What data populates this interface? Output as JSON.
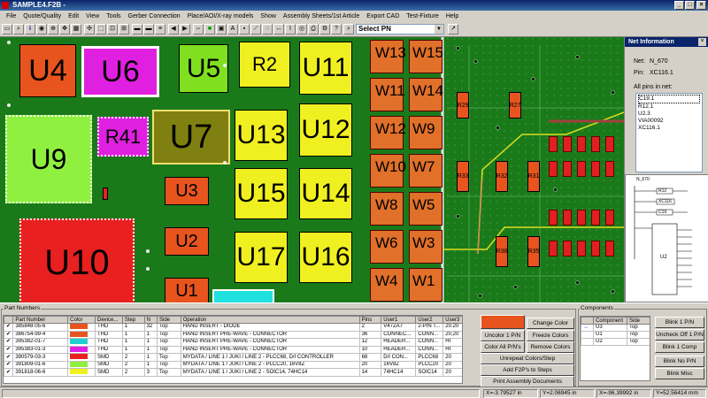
{
  "window": {
    "title": "SAMPLE4.F2B -"
  },
  "menu": [
    "File",
    "Quote/Quality",
    "Edit",
    "View",
    "Tools",
    "Gerber Connection",
    "Place/AOI/X-ray models",
    "Show",
    "Assembly Sheets/1st Article",
    "Export CAD",
    "Test-Fixture",
    "Help"
  ],
  "toolbar": {
    "select_pn": "Select PN"
  },
  "board": {
    "components": [
      {
        "label": "U4",
        "color": "#e8541e"
      },
      {
        "label": "U6",
        "color": "#e020e0"
      },
      {
        "label": "U5",
        "color": "#80e020"
      },
      {
        "label": "R2",
        "color": "#f0f020"
      },
      {
        "label": "U11",
        "color": "#f0f020"
      },
      {
        "label": "U9",
        "color": "#90f040"
      },
      {
        "label": "R41",
        "color": "#e020e0"
      },
      {
        "label": "U7",
        "color": "#808010"
      },
      {
        "label": "U13",
        "color": "#f0f020"
      },
      {
        "label": "U12",
        "color": "#f0f020"
      },
      {
        "label": "U3",
        "color": "#e8541e"
      },
      {
        "label": "U15",
        "color": "#f0f020"
      },
      {
        "label": "U14",
        "color": "#f0f020"
      },
      {
        "label": "U2",
        "color": "#e8541e"
      },
      {
        "label": "U10",
        "color": "#e82020"
      },
      {
        "label": "U17",
        "color": "#f0f020"
      },
      {
        "label": "U16",
        "color": "#f0f020"
      },
      {
        "label": "U1",
        "color": "#e8541e"
      }
    ],
    "v_labels": [
      "W13",
      "W15",
      "W11",
      "W14",
      "W12",
      "W9",
      "W10",
      "W7",
      "W8",
      "W5",
      "W6",
      "W3",
      "W4",
      "W1",
      "W2"
    ],
    "r_labels": [
      "R29",
      "R27",
      "R33",
      "R32",
      "R31",
      "R36",
      "R35"
    ]
  },
  "net_info": {
    "title": "Net Information",
    "net_label": "Net:",
    "net_value": "N_670",
    "pin_label": "Pin:",
    "pin_value": "XC116.1",
    "all_pins_label": "All pins in net:",
    "pins": [
      "C19.1",
      "R12.1",
      "U2.3",
      "VIA00092",
      "XC116.1"
    ],
    "schematic": {
      "net": "N_670",
      "parts": [
        "R12",
        "XC116",
        "C19",
        "U2"
      ]
    }
  },
  "part_numbers": {
    "group_label": "Part Numbers",
    "columns": [
      "",
      "Part Number",
      "Color",
      "Device...",
      "Step",
      "N",
      "Side",
      "Operation",
      "Pins",
      "User1",
      "User2",
      "User3"
    ],
    "rows": [
      {
        "check": "✔",
        "pn": "385848-05-6",
        "color": "#e8541e",
        "device": "THD",
        "step": "1",
        "n": "32",
        "side": "Top",
        "op": "HAND INSERT - DIODE",
        "pins": "2",
        "u1": "V47ZA7",
        "u2": "2-PIN T...",
        "u3": "20.20"
      },
      {
        "check": "✔",
        "pn": "386754-99-4",
        "color": "#e8541e",
        "device": "THD",
        "step": "1",
        "n": "1",
        "side": "Top",
        "op": "HAND INSERT PRE-WAVE - CONNECTOR",
        "pins": "36",
        "u1": "CONNEC...",
        "u2": "CONN...",
        "u3": "20,20"
      },
      {
        "check": "✔",
        "pn": "395382-01-7",
        "color": "#20d0d0",
        "device": "THD",
        "step": "1",
        "n": "1",
        "side": "Top",
        "op": "HAND INSERT PRE-WAVE - CONNECTOR",
        "pins": "12",
        "u1": "HEADER...",
        "u2": "CONN...",
        "u3": "HI"
      },
      {
        "check": "✔",
        "pn": "395383-01-3",
        "color": "#e020e0",
        "device": "THD",
        "step": "1",
        "n": "1",
        "side": "Top",
        "op": "HAND INSERT PRE-WAVE - CONNECTOR",
        "pins": "10",
        "u1": "HEADER...",
        "u2": "CONN...",
        "u3": "HI"
      },
      {
        "check": "✔",
        "pn": "390579-03-3",
        "color": "#e82020",
        "device": "SMD",
        "step": "2",
        "n": "1",
        "side": "Top",
        "op": "MYDATA / LINE 1 / JUKI / LINE 2 - PLCC68, D/I CONTROLLER",
        "pins": "68",
        "u1": "D/I CON...",
        "u2": "PLCC68",
        "u3": "20"
      },
      {
        "check": "✔",
        "pn": "391809-01-6",
        "color": "#90f040",
        "device": "SMD",
        "step": "2",
        "n": "1",
        "side": "Top",
        "op": "MYDATA / LINE 1 / JUKI / LINE 2 - PLCC20, 16V8Z",
        "pins": "20",
        "u1": "16V8Z",
        "u2": "PLCC20",
        "u3": "20"
      },
      {
        "check": "✔",
        "pn": "391818-06-6",
        "color": "#f0f020",
        "device": "SMD",
        "step": "2",
        "n": "3",
        "side": "Top",
        "op": "MYDATA / LINE 1 / JUKI / LINE 2 - SOIC14, 74HC14",
        "pins": "14",
        "u1": "74HC14",
        "u2": "SOIC14",
        "u3": "20"
      }
    ]
  },
  "actions": {
    "change_color": "Change Color",
    "uncolor_pn": "Uncolor 1 P/N",
    "freeze_colors": "Freeze Colors",
    "color_all_pn": "Color All P/N's",
    "remove_colors": "Remove Colors",
    "unrepeat_colors": "Unrepeat Colors/Step",
    "add_f2p": "Add F2P's to Steps",
    "print_assembly": "Print Assembly Documents"
  },
  "components_panel": {
    "group_label": "Components",
    "columns": [
      "Component",
      "Side"
    ],
    "rows": [
      {
        "c": "U3",
        "s": "Top"
      },
      {
        "c": "U1",
        "s": "Top"
      },
      {
        "c": "U2",
        "s": "Top"
      }
    ],
    "buttons": [
      "Blink 1 P/N",
      "Uncheck Off 1 P/N",
      "Blink 1 Comp",
      "Blink No P/N",
      "Blink Misc"
    ]
  },
  "status": {
    "x1": "X=-3.79527 in",
    "y1": "Y=2.06945 in",
    "x2": "X=-96.39992 in",
    "y2": "Y=52.56414 mm"
  },
  "colors": {
    "board": "#1a7a1a",
    "titlebar": "#0a246a"
  }
}
